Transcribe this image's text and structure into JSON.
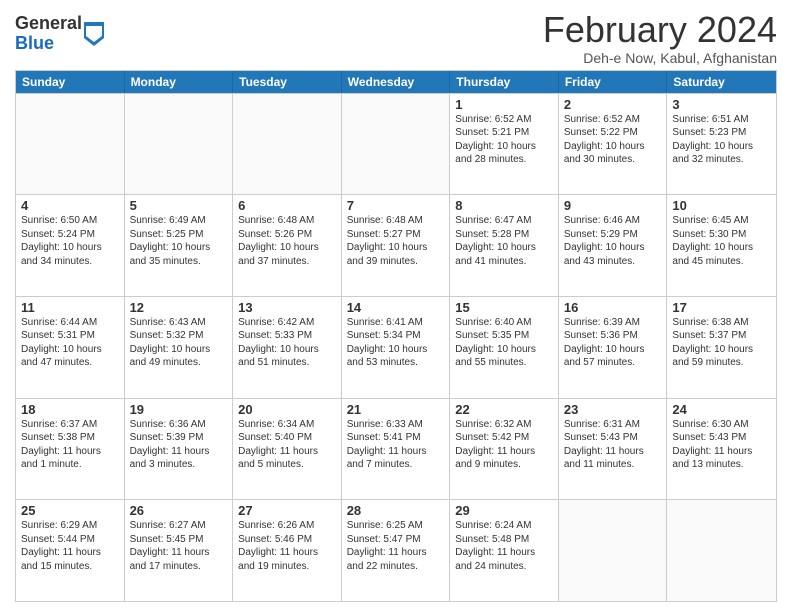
{
  "logo": {
    "general": "General",
    "blue": "Blue"
  },
  "title": "February 2024",
  "location": "Deh-e Now, Kabul, Afghanistan",
  "weekdays": [
    "Sunday",
    "Monday",
    "Tuesday",
    "Wednesday",
    "Thursday",
    "Friday",
    "Saturday"
  ],
  "rows": [
    [
      {
        "date": "",
        "info": ""
      },
      {
        "date": "",
        "info": ""
      },
      {
        "date": "",
        "info": ""
      },
      {
        "date": "",
        "info": ""
      },
      {
        "date": "1",
        "info": "Sunrise: 6:52 AM\nSunset: 5:21 PM\nDaylight: 10 hours and 28 minutes."
      },
      {
        "date": "2",
        "info": "Sunrise: 6:52 AM\nSunset: 5:22 PM\nDaylight: 10 hours and 30 minutes."
      },
      {
        "date": "3",
        "info": "Sunrise: 6:51 AM\nSunset: 5:23 PM\nDaylight: 10 hours and 32 minutes."
      }
    ],
    [
      {
        "date": "4",
        "info": "Sunrise: 6:50 AM\nSunset: 5:24 PM\nDaylight: 10 hours and 34 minutes."
      },
      {
        "date": "5",
        "info": "Sunrise: 6:49 AM\nSunset: 5:25 PM\nDaylight: 10 hours and 35 minutes."
      },
      {
        "date": "6",
        "info": "Sunrise: 6:48 AM\nSunset: 5:26 PM\nDaylight: 10 hours and 37 minutes."
      },
      {
        "date": "7",
        "info": "Sunrise: 6:48 AM\nSunset: 5:27 PM\nDaylight: 10 hours and 39 minutes."
      },
      {
        "date": "8",
        "info": "Sunrise: 6:47 AM\nSunset: 5:28 PM\nDaylight: 10 hours and 41 minutes."
      },
      {
        "date": "9",
        "info": "Sunrise: 6:46 AM\nSunset: 5:29 PM\nDaylight: 10 hours and 43 minutes."
      },
      {
        "date": "10",
        "info": "Sunrise: 6:45 AM\nSunset: 5:30 PM\nDaylight: 10 hours and 45 minutes."
      }
    ],
    [
      {
        "date": "11",
        "info": "Sunrise: 6:44 AM\nSunset: 5:31 PM\nDaylight: 10 hours and 47 minutes."
      },
      {
        "date": "12",
        "info": "Sunrise: 6:43 AM\nSunset: 5:32 PM\nDaylight: 10 hours and 49 minutes."
      },
      {
        "date": "13",
        "info": "Sunrise: 6:42 AM\nSunset: 5:33 PM\nDaylight: 10 hours and 51 minutes."
      },
      {
        "date": "14",
        "info": "Sunrise: 6:41 AM\nSunset: 5:34 PM\nDaylight: 10 hours and 53 minutes."
      },
      {
        "date": "15",
        "info": "Sunrise: 6:40 AM\nSunset: 5:35 PM\nDaylight: 10 hours and 55 minutes."
      },
      {
        "date": "16",
        "info": "Sunrise: 6:39 AM\nSunset: 5:36 PM\nDaylight: 10 hours and 57 minutes."
      },
      {
        "date": "17",
        "info": "Sunrise: 6:38 AM\nSunset: 5:37 PM\nDaylight: 10 hours and 59 minutes."
      }
    ],
    [
      {
        "date": "18",
        "info": "Sunrise: 6:37 AM\nSunset: 5:38 PM\nDaylight: 11 hours and 1 minute."
      },
      {
        "date": "19",
        "info": "Sunrise: 6:36 AM\nSunset: 5:39 PM\nDaylight: 11 hours and 3 minutes."
      },
      {
        "date": "20",
        "info": "Sunrise: 6:34 AM\nSunset: 5:40 PM\nDaylight: 11 hours and 5 minutes."
      },
      {
        "date": "21",
        "info": "Sunrise: 6:33 AM\nSunset: 5:41 PM\nDaylight: 11 hours and 7 minutes."
      },
      {
        "date": "22",
        "info": "Sunrise: 6:32 AM\nSunset: 5:42 PM\nDaylight: 11 hours and 9 minutes."
      },
      {
        "date": "23",
        "info": "Sunrise: 6:31 AM\nSunset: 5:43 PM\nDaylight: 11 hours and 11 minutes."
      },
      {
        "date": "24",
        "info": "Sunrise: 6:30 AM\nSunset: 5:43 PM\nDaylight: 11 hours and 13 minutes."
      }
    ],
    [
      {
        "date": "25",
        "info": "Sunrise: 6:29 AM\nSunset: 5:44 PM\nDaylight: 11 hours and 15 minutes."
      },
      {
        "date": "26",
        "info": "Sunrise: 6:27 AM\nSunset: 5:45 PM\nDaylight: 11 hours and 17 minutes."
      },
      {
        "date": "27",
        "info": "Sunrise: 6:26 AM\nSunset: 5:46 PM\nDaylight: 11 hours and 19 minutes."
      },
      {
        "date": "28",
        "info": "Sunrise: 6:25 AM\nSunset: 5:47 PM\nDaylight: 11 hours and 22 minutes."
      },
      {
        "date": "29",
        "info": "Sunrise: 6:24 AM\nSunset: 5:48 PM\nDaylight: 11 hours and 24 minutes."
      },
      {
        "date": "",
        "info": ""
      },
      {
        "date": "",
        "info": ""
      }
    ]
  ]
}
